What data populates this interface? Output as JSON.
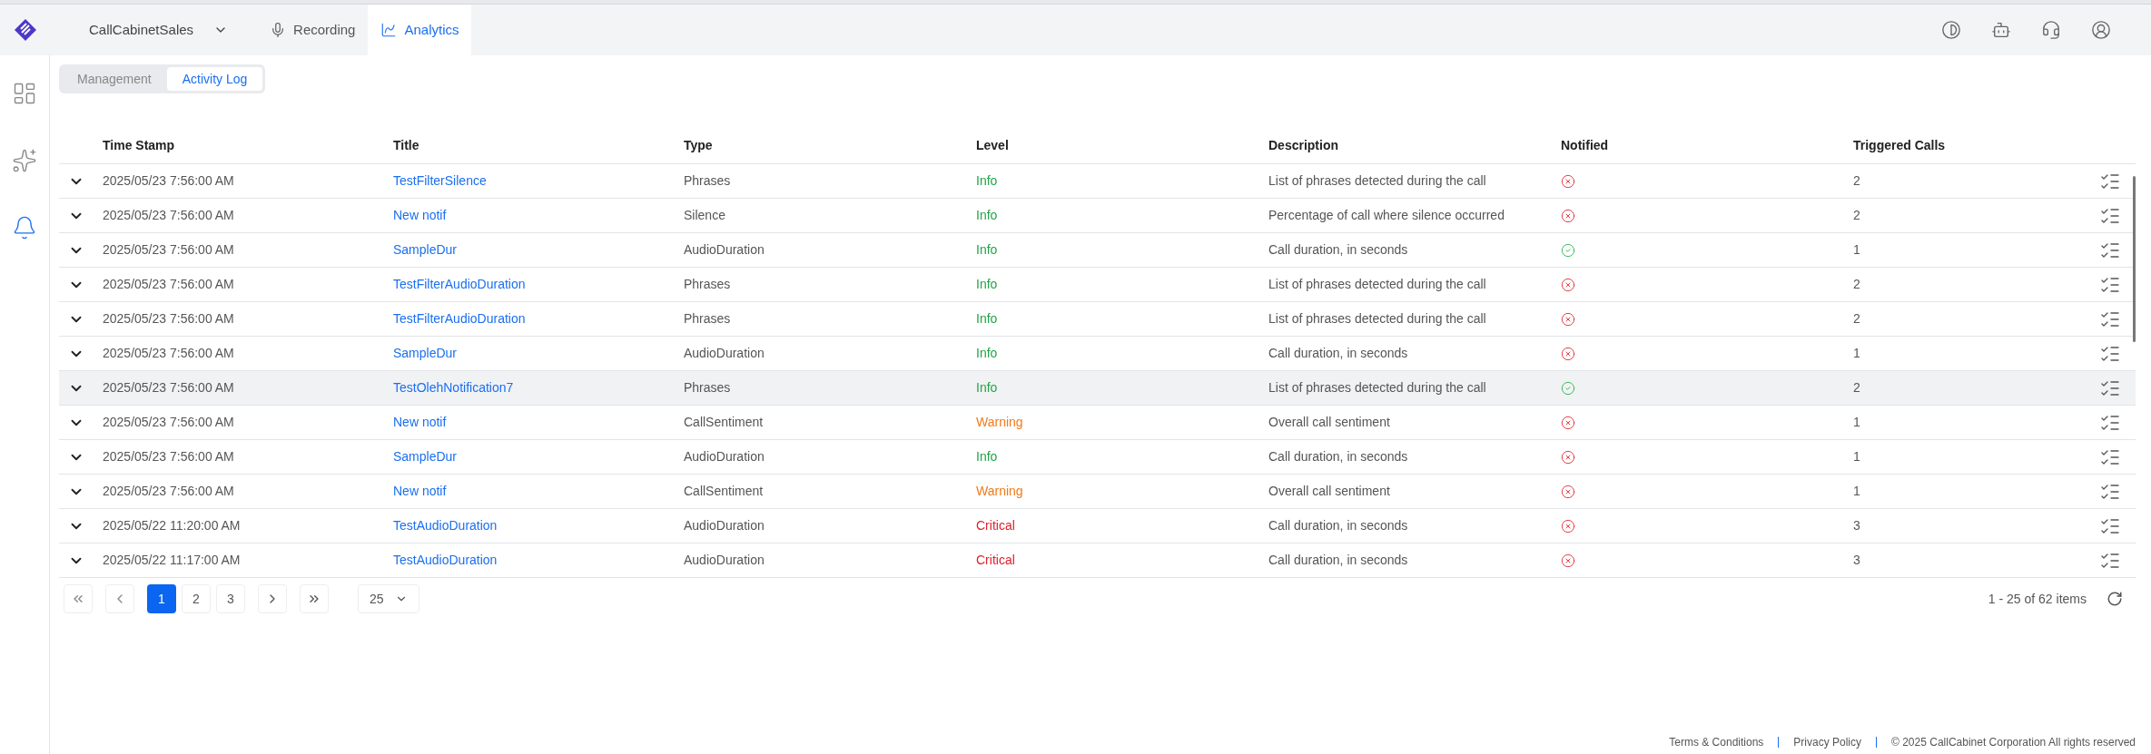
{
  "topbar": {
    "workspace": "CallCabinetSales",
    "nav": [
      {
        "label": "Recording",
        "selected": false
      },
      {
        "label": "Analytics",
        "selected": true
      }
    ]
  },
  "sidebar": {
    "items": [
      {
        "selected": false
      },
      {
        "selected": false
      },
      {
        "selected": true
      }
    ]
  },
  "tabs": [
    {
      "label": "Management",
      "selected": false
    },
    {
      "label": "Activity Log",
      "selected": true
    }
  ],
  "table": {
    "columns": [
      "Time Stamp",
      "Title",
      "Type",
      "Level",
      "Description",
      "Notified",
      "Triggered Calls"
    ],
    "rows": [
      {
        "time": "2025/05/23 7:56:00 AM",
        "title": "TestFilterSilence",
        "type": "Phrases",
        "level": {
          "text": "Info",
          "color": "#22a447"
        },
        "description": "List of phrases detected during the call",
        "notified": false,
        "triggered": "2",
        "highlighted": false
      },
      {
        "time": "2025/05/23 7:56:00 AM",
        "title": "New notif",
        "type": "Silence",
        "level": {
          "text": "Info",
          "color": "#22a447"
        },
        "description": "Percentage of call where silence occurred",
        "notified": false,
        "triggered": "2",
        "highlighted": false
      },
      {
        "time": "2025/05/23 7:56:00 AM",
        "title": "SampleDur",
        "type": "AudioDuration",
        "level": {
          "text": "Info",
          "color": "#22a447"
        },
        "description": "Call duration, in seconds",
        "notified": true,
        "triggered": "1",
        "highlighted": false
      },
      {
        "time": "2025/05/23 7:56:00 AM",
        "title": "TestFilterAudioDuration",
        "type": "Phrases",
        "level": {
          "text": "Info",
          "color": "#22a447"
        },
        "description": "List of phrases detected during the call",
        "notified": false,
        "triggered": "2",
        "highlighted": false
      },
      {
        "time": "2025/05/23 7:56:00 AM",
        "title": "TestFilterAudioDuration",
        "type": "Phrases",
        "level": {
          "text": "Info",
          "color": "#22a447"
        },
        "description": "List of phrases detected during the call",
        "notified": false,
        "triggered": "2",
        "highlighted": false
      },
      {
        "time": "2025/05/23 7:56:00 AM",
        "title": "SampleDur",
        "type": "AudioDuration",
        "level": {
          "text": "Info",
          "color": "#22a447"
        },
        "description": "Call duration, in seconds",
        "notified": false,
        "triggered": "1",
        "highlighted": false
      },
      {
        "time": "2025/05/23 7:56:00 AM",
        "title": "TestOlehNotification7",
        "type": "Phrases",
        "level": {
          "text": "Info",
          "color": "#22a447"
        },
        "description": "List of phrases detected during the call",
        "notified": true,
        "triggered": "2",
        "highlighted": true
      },
      {
        "time": "2025/05/23 7:56:00 AM",
        "title": "New notif",
        "type": "CallSentiment",
        "level": {
          "text": "Warning",
          "color": "#f07a1a"
        },
        "description": "Overall call sentiment",
        "notified": false,
        "triggered": "1",
        "highlighted": false
      },
      {
        "time": "2025/05/23 7:56:00 AM",
        "title": "SampleDur",
        "type": "AudioDuration",
        "level": {
          "text": "Info",
          "color": "#22a447"
        },
        "description": "Call duration, in seconds",
        "notified": false,
        "triggered": "1",
        "highlighted": false
      },
      {
        "time": "2025/05/23 7:56:00 AM",
        "title": "New notif",
        "type": "CallSentiment",
        "level": {
          "text": "Warning",
          "color": "#f07a1a"
        },
        "description": "Overall call sentiment",
        "notified": false,
        "triggered": "1",
        "highlighted": false
      },
      {
        "time": "2025/05/22 11:20:00 AM",
        "title": "TestAudioDuration",
        "type": "AudioDuration",
        "level": {
          "text": "Critical",
          "color": "#e0202b"
        },
        "description": "Call duration, in seconds",
        "notified": false,
        "triggered": "3",
        "highlighted": false
      },
      {
        "time": "2025/05/22 11:17:00 AM",
        "title": "TestAudioDuration",
        "type": "AudioDuration",
        "level": {
          "text": "Critical",
          "color": "#e0202b"
        },
        "description": "Call duration, in seconds",
        "notified": false,
        "triggered": "3",
        "highlighted": false
      }
    ]
  },
  "pagination": {
    "pages": [
      {
        "label": "1",
        "selected": true
      },
      {
        "label": "2",
        "selected": false
      },
      {
        "label": "3",
        "selected": false
      }
    ],
    "page_size": "25",
    "summary": "1 - 25 of 62 items"
  },
  "footer": {
    "links": [
      "Terms & Conditions",
      "Privacy Policy"
    ],
    "copyright": "© 2025 CallCabinet Corporation All rights reserved"
  }
}
